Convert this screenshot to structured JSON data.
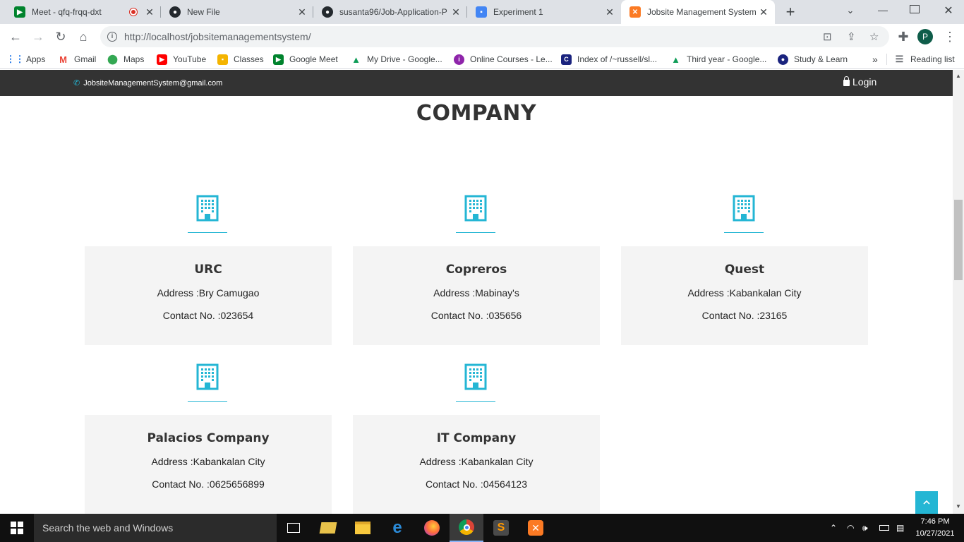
{
  "tabs": [
    {
      "title": "Meet - qfq-frqq-dxt",
      "icon": "google-meet-icon"
    },
    {
      "title": "New File",
      "icon": "github-icon"
    },
    {
      "title": "susanta96/Job-Application-P",
      "icon": "github-icon"
    },
    {
      "title": "Experiment 1",
      "icon": "google-forms-icon"
    },
    {
      "title": "Jobsite Management System",
      "icon": "xampp-icon"
    }
  ],
  "address_bar": {
    "url": "http://localhost/jobsitemanagementsystem/"
  },
  "profile_initial": "P",
  "bookmarks": [
    {
      "label": "Apps"
    },
    {
      "label": "Gmail"
    },
    {
      "label": "Maps"
    },
    {
      "label": "YouTube"
    },
    {
      "label": "Classes"
    },
    {
      "label": "Google Meet"
    },
    {
      "label": "My Drive - Google..."
    },
    {
      "label": "Online Courses - Le..."
    },
    {
      "label": "Index of /~russell/sl..."
    },
    {
      "label": "Third year - Google..."
    },
    {
      "label": "Study & Learn"
    }
  ],
  "bookmarks_overflow": "»",
  "reading_list": "Reading list",
  "site": {
    "contact_email": "JobsiteManagementSystem@gmail.com",
    "login_label": "Login",
    "section_title": "COMPANY",
    "companies": [
      {
        "name": "URC",
        "address": "Address :Bry Camugao",
        "contact": "Contact No. :023654"
      },
      {
        "name": "Copreros",
        "address": "Address :Mabinay's",
        "contact": "Contact No. :035656"
      },
      {
        "name": "Quest",
        "address": "Address :Kabankalan City",
        "contact": "Contact No. :23165"
      },
      {
        "name": "Palacios Company",
        "address": "Address :Kabankalan City",
        "contact": "Contact No. :0625656899"
      },
      {
        "name": "IT Company",
        "address": "Address :Kabankalan City",
        "contact": "Contact No. :04564123"
      }
    ],
    "accent_color": "#24b6d4",
    "topbar_color": "#333333"
  },
  "taskbar": {
    "search_placeholder": "Search the web and Windows",
    "time": "7:46 PM",
    "date": "10/27/2021"
  }
}
